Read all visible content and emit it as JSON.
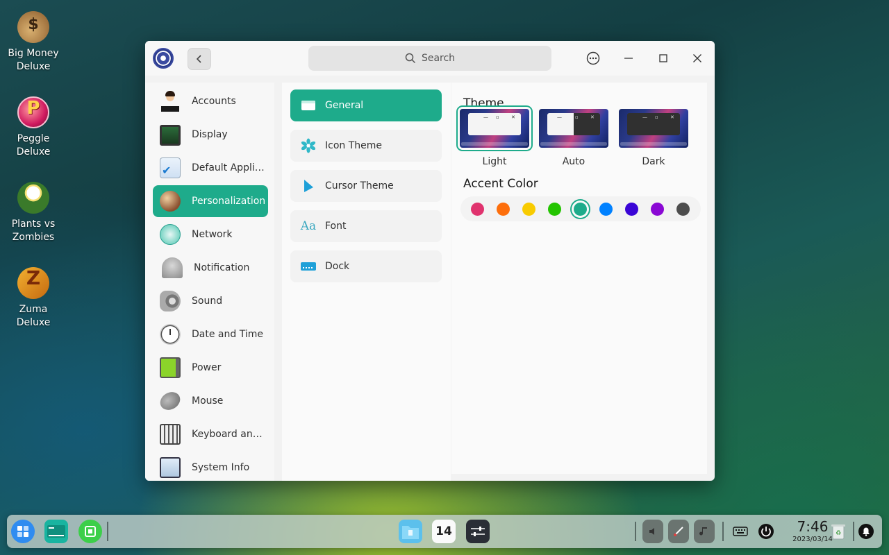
{
  "desktop": {
    "icons": [
      {
        "line1": "Big Money",
        "line2": "Deluxe"
      },
      {
        "line1": "Peggle",
        "line2": "Deluxe"
      },
      {
        "line1": "Plants vs",
        "line2": "Zombies"
      },
      {
        "line1": "Zuma",
        "line2": "Deluxe"
      }
    ]
  },
  "window": {
    "search_placeholder": "Search",
    "sidebar": [
      {
        "label": "Accounts",
        "icon": "accounts-icon"
      },
      {
        "label": "Display",
        "icon": "display-icon"
      },
      {
        "label": "Default Applic...",
        "icon": "default-applications-icon"
      },
      {
        "label": "Personalization",
        "icon": "personalization-icon",
        "active": true
      },
      {
        "label": "Network",
        "icon": "network-icon"
      },
      {
        "label": "Notification",
        "icon": "notification-bell-icon"
      },
      {
        "label": "Sound",
        "icon": "speaker-icon"
      },
      {
        "label": "Date and Time",
        "icon": "clock-icon"
      },
      {
        "label": "Power",
        "icon": "battery-icon"
      },
      {
        "label": "Mouse",
        "icon": "mouse-icon"
      },
      {
        "label": "Keyboard and ...",
        "icon": "keyboard-icon"
      },
      {
        "label": "System Info",
        "icon": "system-info-icon"
      }
    ],
    "subnav": [
      {
        "label": "General",
        "icon": "general-window-icon",
        "active": true
      },
      {
        "label": "Icon Theme",
        "icon": "icon-theme-icon"
      },
      {
        "label": "Cursor Theme",
        "icon": "cursor-icon"
      },
      {
        "label": "Font",
        "icon": "font-icon"
      },
      {
        "label": "Dock",
        "icon": "dock-icon"
      }
    ],
    "main": {
      "theme_title": "Theme",
      "themes": [
        {
          "label": "Light",
          "selected": true
        },
        {
          "label": "Auto"
        },
        {
          "label": "Dark"
        }
      ],
      "accent_title": "Accent Color",
      "accent_colors": [
        "#e0336e",
        "#fd6e0b",
        "#f8cb00",
        "#23c400",
        "#1eab8b",
        "#0081ff",
        "#3a05d6",
        "#8a08d4",
        "#4d4d4d"
      ],
      "accent_selected_index": 4
    }
  },
  "taskbar": {
    "time": "7:46",
    "date": "2023/03/14",
    "calendar_day": "14"
  },
  "colors": {
    "accent": "#1eab8b"
  }
}
